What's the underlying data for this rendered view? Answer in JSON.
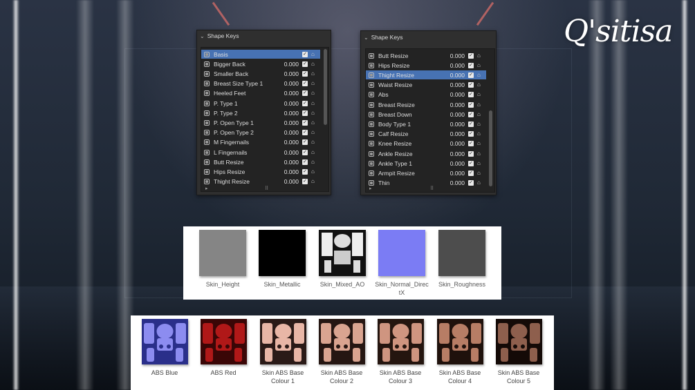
{
  "branding": {
    "logo_text": "Q'sitisa"
  },
  "left_panel": {
    "title": "Shape Keys",
    "keys": [
      {
        "name": "Basis",
        "value": "",
        "selected": true
      },
      {
        "name": "Bigger Back",
        "value": "0.000"
      },
      {
        "name": "Smaller Back",
        "value": "0.000"
      },
      {
        "name": "Breast Size Type 1",
        "value": "0.000"
      },
      {
        "name": "Heeled Feet",
        "value": "0.000"
      },
      {
        "name": "P. Type 1",
        "value": "0.000"
      },
      {
        "name": "P. Type 2",
        "value": "0.000"
      },
      {
        "name": "P. Open Type 1",
        "value": "0.000"
      },
      {
        "name": "P. Open Type 2",
        "value": "0.000"
      },
      {
        "name": "M Fingernails",
        "value": "0.000"
      },
      {
        "name": "L Fingernails",
        "value": "0.000"
      },
      {
        "name": "Butt Resize",
        "value": "0.000"
      },
      {
        "name": "Hips Resize",
        "value": "0.000"
      },
      {
        "name": "Thight Resize",
        "value": "0.000"
      }
    ]
  },
  "right_panel": {
    "title": "Shape Keys",
    "keys": [
      {
        "name": "Butt Resize",
        "value": "0.000"
      },
      {
        "name": "Hips Resize",
        "value": "0.000"
      },
      {
        "name": "Thight Resize",
        "value": "0.000",
        "selected": true
      },
      {
        "name": "Waist Resize",
        "value": "0.000"
      },
      {
        "name": "Abs",
        "value": "0.000"
      },
      {
        "name": "Breast Resize",
        "value": "0.000"
      },
      {
        "name": "Breast Down",
        "value": "0.000"
      },
      {
        "name": "Body Type 1",
        "value": "0.000"
      },
      {
        "name": "Calf Resize",
        "value": "0.000"
      },
      {
        "name": "Knee Resize",
        "value": "0.000"
      },
      {
        "name": "Ankle Resize",
        "value": "0.000"
      },
      {
        "name": "Ankle Type 1",
        "value": "0.000"
      },
      {
        "name": "Armpit Resize",
        "value": "0.000"
      },
      {
        "name": "Thin",
        "value": "0.000"
      }
    ]
  },
  "textures": [
    {
      "label": "Skin_Height",
      "color": "#858585"
    },
    {
      "label": "Skin_Metallic",
      "color": "#000000"
    },
    {
      "label": "Skin_Mixed_AO",
      "color": "#f2f2f2"
    },
    {
      "label": "Skin_Normal_DirectX",
      "color": "#7b7cf4"
    },
    {
      "label": "Skin_Roughness",
      "color": "#4d4d4d"
    }
  ],
  "skins": [
    {
      "label": "ABS Blue",
      "bg": "#2a2f8a",
      "fg": "#8c8cf0"
    },
    {
      "label": "ABS Red",
      "bg": "#3a0606",
      "fg": "#b01818"
    },
    {
      "label": "Skin ABS Base Colour 1",
      "bg": "#2a1a17",
      "fg": "#e8b6a6"
    },
    {
      "label": "Skin ABS Base Colour 2",
      "bg": "#251612",
      "fg": "#d9a490"
    },
    {
      "label": "Skin ABS Base Colour 3",
      "bg": "#24150f",
      "fg": "#cf9580"
    },
    {
      "label": "Skin ABS Base Colour 4",
      "bg": "#1f110c",
      "fg": "#b77d65"
    },
    {
      "label": "Skin ABS Base Colour 5",
      "bg": "#140a07",
      "fg": "#8e5f4d"
    }
  ]
}
